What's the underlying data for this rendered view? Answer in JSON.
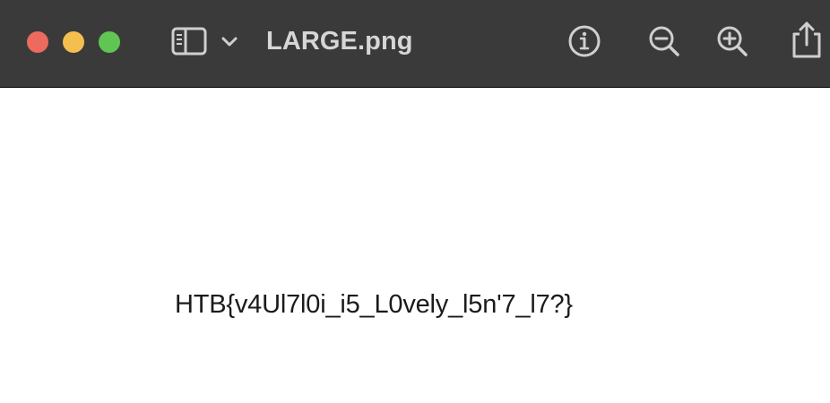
{
  "window": {
    "title": "LARGE.png",
    "traffic_lights": {
      "close_color": "#ec6a5e",
      "minimize_color": "#f4bf4f",
      "zoom_color": "#61c554"
    },
    "toolbar": {
      "icons": [
        "sidebar-toggle-icon",
        "chevron-down-icon",
        "info-icon",
        "zoom-out-icon",
        "zoom-in-icon",
        "share-icon"
      ],
      "icon_color": "#cfcfcf",
      "background": "#3a3a3a"
    }
  },
  "image": {
    "text": "HTB{v4Ul7l0i_i5_L0vely_l5n'7_l7?}",
    "background": "#ffffff"
  }
}
